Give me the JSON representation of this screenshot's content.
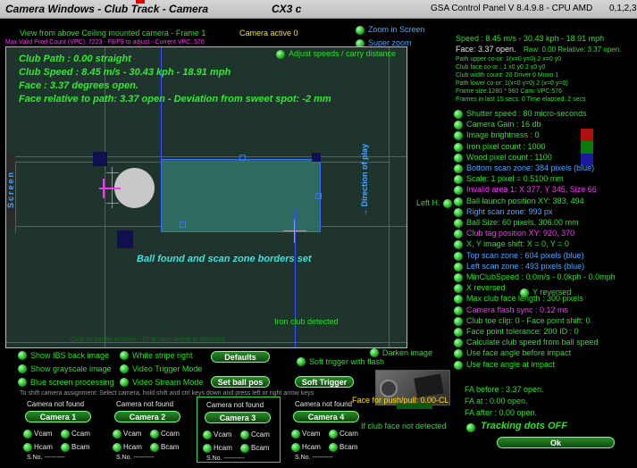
{
  "window": {
    "title": "Camera Windows - Club Track - Camera",
    "cam_model": "CX3 c",
    "app": "GSA Control Panel V 8.4.9.8 - CPU AMD",
    "version_digits": "0,1,2,3"
  },
  "scene": {
    "view_text": "View from above Ceiling mounted camera - Frame 1",
    "camera_active": "Camera active 0",
    "pixel_count_line": "Max Valid Pixel Count (VPC): 7223  - F8/F9 to adjust - Current VPC: 576",
    "club_path": "Club Path : 0.00 straight",
    "club_speed": "Club Speed : 8.45 m/s - 30.43 kph - 18.91 mph",
    "face": "Face : 3.37 degrees open.",
    "face_relative": "Face relative to path: 3.37 open - Deviation from sweet spot: -2 mm",
    "adjust_label": "Adjust speeds / carry distance",
    "screen_label": "Screen",
    "ball_found": "Ball found and scan zone borders set",
    "direction_label": "Direction of play",
    "iron_detected": "Iron club detected",
    "footer_hint": "Click on border to move - F7 to store image to clipboard"
  },
  "zoom": {
    "zoom_in_screen": "Zoom in Screen",
    "super_zoom": "Super zoom"
  },
  "stats": {
    "speed": "Speed : 8.45 m/s - 30.43 kph - 18.91 mph",
    "face": "Face: 3.37 open.",
    "raw": "Raw: 0.00 Relative: 3.37 open.",
    "lines": [
      "Path upper co-or: 1(x=0 y=0) 2 x=0 y0",
      "Club face co-or : 1 x0 y0 2 x0 y0",
      "Club width count: 20  Driver 0 Mono 1",
      "Path lower co-or: 1(x=0 y=0) 2 (x=0 y=0)",
      "Frame size:1280 * 960 Cam: VPC:576",
      "Frames in last 15 secs: 0 Time elapsed:  2 secs"
    ]
  },
  "settings": [
    {
      "label": "Shutter speed : 80 micro-seconds",
      "color": "#28e028"
    },
    {
      "label": "Camera Gain : 16 db",
      "color": "#28e028"
    },
    {
      "label": "Image brightness : 0",
      "color": "#28e028"
    },
    {
      "label": "Iron pixel count : 1000",
      "color": "#28e028"
    },
    {
      "label": "Wood pixel count : 1100",
      "color": "#28e028"
    },
    {
      "label": "Bottom scan zone: 384 pixels (blue)",
      "color": "#4aa8ff"
    },
    {
      "label": "Scale: 1 pixel = 0.5100 mm",
      "color": "#28e028"
    },
    {
      "label": "Invalid area 1: X 377, Y 345, Size 66",
      "color": "#ff30ff"
    },
    {
      "label": "Ball launch position XY: 383, 494",
      "color": "#28e028"
    },
    {
      "label": "Right scan zone: 993 px",
      "color": "#4aa8ff"
    },
    {
      "label": "Ball Size: 60 pixels, 306.00 mm",
      "color": "#28e028"
    },
    {
      "label": "Club tag position XY: 920, 370",
      "color": "#ff30ff"
    },
    {
      "label": "X, Y image shift: X = 0, Y = 0",
      "color": "#28e028"
    },
    {
      "label": "Top scan zone : 604 pixels (blue)",
      "color": "#4aa8ff"
    },
    {
      "label": "Left scan zone : 493 pixels (blue)",
      "color": "#4aa8ff"
    },
    {
      "label": "MinClubSpeed : 0.0m/s - 0.0kph - 0.0mph",
      "color": "#28e028"
    },
    {
      "label": "X reversed",
      "color": "#28e028"
    },
    {
      "label": "Max club face length : 300 pixels",
      "color": "#28e028"
    },
    {
      "label": "Camera flash sync : 0.12 ms",
      "color": "#ff30ff"
    },
    {
      "label": "Club toe clip: 0 - Face point shift: 0",
      "color": "#28e028"
    },
    {
      "label": "Face point tolerance: 200 ID : 0",
      "color": "#28e028"
    },
    {
      "label": "Calculate club speed from ball speed",
      "color": "#28e028"
    },
    {
      "label": "Use face angle before impact",
      "color": "#28e028"
    },
    {
      "label": "Use face angle at impact",
      "color": "#28e028"
    }
  ],
  "y_reversed": "Y reversed",
  "left_h": "Left H.",
  "fa": {
    "before": "FA before :  3.37 open.",
    "at": "FA at  :      0.00 open.",
    "after": "FA after :    0.00 open."
  },
  "tracking": "Tracking dots OFF",
  "ok_button": "Ok",
  "swatch_colors": {
    "red": "#b01010",
    "green": "#0a7a0a",
    "blue": "#1a1aa0"
  },
  "options": {
    "show_ibs": "Show IBS back image",
    "white_stripe": "White stripe right",
    "defaults": "Defaults",
    "darken": "Darken image",
    "soft_trigger_flash": "Soft trigger with flash",
    "show_grayscale": "Show grayscale image",
    "video_trigger": "Video Trigger Mode",
    "blue_screen": "Blue screen processing",
    "video_stream": "Video Stream Mode",
    "set_ball_pos": "Set ball pos",
    "soft_trigger": "Soft Trigger",
    "cam_assign_hint": "To shift camera assignment: Select camera, hold shift and ctrl keys down and press left or right arrow keys",
    "face_push_pull": "Face for push/pull: 0.00-CL",
    "if_club_face": "If club face not detected"
  },
  "cameras": [
    {
      "status": "Camera not found",
      "button": "Camera 1",
      "a": "Vcam",
      "b": "Ccam",
      "c": "Hcam",
      "d": "Bcam",
      "sno": "S.No. ----------"
    },
    {
      "status": "Camera not found",
      "button": "Camera 2",
      "a": "Vcam",
      "b": "Ccam",
      "c": "Hcam",
      "d": "Bcam",
      "sno": "S.No. ----------"
    },
    {
      "status": "Camera not found",
      "button": "Camera 3",
      "a": "Vcam",
      "b": "Ccam",
      "c": "Hcam",
      "d": "Bcam",
      "sno": "S.No. ----------"
    },
    {
      "status": "Camera not found",
      "button": "Camera 4",
      "a": "Vcam",
      "b": "Ccam",
      "c": "Hcam",
      "d": "Bcam",
      "sno": "S.No. ----------"
    }
  ]
}
